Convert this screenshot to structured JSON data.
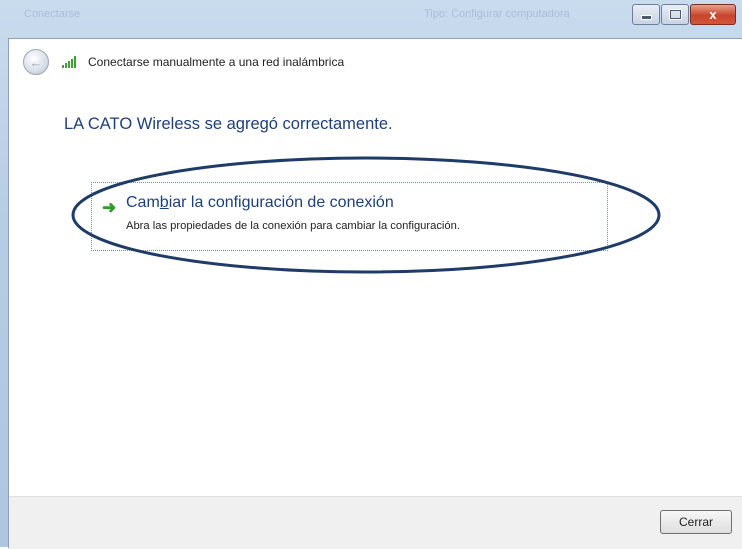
{
  "window": {
    "ghost_left": "Conectarse",
    "ghost_right": "Tipo: Configurar computadora"
  },
  "caption_buttons": {
    "minimize": "",
    "maximize": "",
    "close": "x"
  },
  "nav": {
    "title": "Conectarse manualmente a una red inalámbrica"
  },
  "main": {
    "heading": "LA CATO Wireless se agregó correctamente."
  },
  "option": {
    "title_prefix": "Cam",
    "title_access_key": "b",
    "title_suffix": "iar la configuración de conexión",
    "description": "Abra las propiedades de la conexión para cambiar la configuración."
  },
  "footer": {
    "close_label": "Cerrar"
  },
  "colors": {
    "heading": "#1d3f7c",
    "arrow": "#2e9b2b",
    "annotation_ellipse": "#1f3b67"
  }
}
